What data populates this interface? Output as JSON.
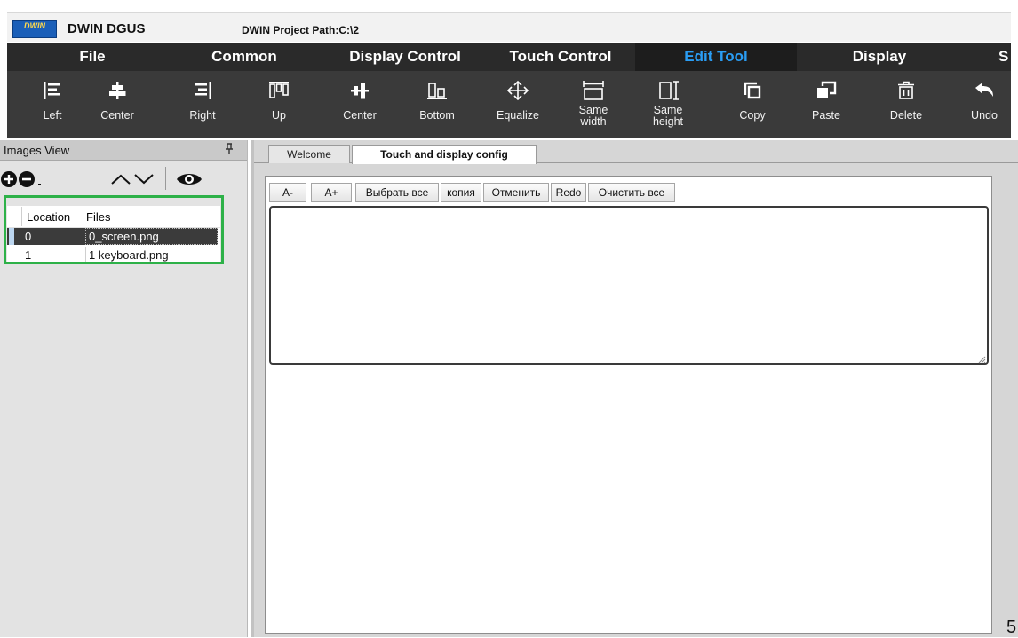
{
  "app": {
    "name": "DWIN DGUS",
    "logo_text": "DWIN",
    "project_path": "DWIN Project Path:C:\\2"
  },
  "menu": [
    {
      "label": "File"
    },
    {
      "label": "Common"
    },
    {
      "label": "Display Control"
    },
    {
      "label": "Touch Control"
    },
    {
      "label": "Edit Tool",
      "active": true
    },
    {
      "label": "Display"
    },
    {
      "label": "S"
    }
  ],
  "toolbar": [
    {
      "label": "Left",
      "icon": "align-left-icon"
    },
    {
      "label": "Center",
      "icon": "align-center-icon"
    },
    {
      "label": "Right",
      "icon": "align-right-icon"
    },
    {
      "label": "Up",
      "icon": "align-top-icon"
    },
    {
      "label": "Center",
      "icon": "align-middle-icon"
    },
    {
      "label": "Bottom",
      "icon": "align-bottom-icon"
    },
    {
      "label": "Equalize",
      "icon": "equalize-icon"
    },
    {
      "label": "Same width",
      "line1": "Same",
      "line2": "width",
      "icon": "same-width-icon"
    },
    {
      "label": "Same height",
      "line1": "Same",
      "line2": "height",
      "icon": "same-height-icon"
    },
    {
      "label": "Copy",
      "icon": "copy-icon"
    },
    {
      "label": "Paste",
      "icon": "paste-icon"
    },
    {
      "label": "Delete",
      "icon": "trash-icon"
    },
    {
      "label": "Undo",
      "icon": "undo-icon"
    }
  ],
  "images_view": {
    "title": "Images View",
    "columns": [
      "Location",
      "Files"
    ],
    "rows": [
      {
        "location": "0",
        "file": "0_screen.png",
        "selected": true
      },
      {
        "location": "1",
        "file": "1 keyboard.png",
        "selected": false
      }
    ]
  },
  "tabs": [
    {
      "label": "Welcome",
      "active": false
    },
    {
      "label": "Touch and display config",
      "active": true
    }
  ],
  "editor": {
    "buttons": [
      "A-",
      "A+",
      "Выбрать все",
      "копия",
      "Отменить",
      "Redo",
      "Очистить все"
    ],
    "text": ""
  },
  "stray_text": "5",
  "colors": {
    "menu_bg": "#2a2a2a",
    "toolbar_bg": "#3a3a3a",
    "active_menu_text": "#2a9df4",
    "highlight_box": "#2db148",
    "selected_row": "#3b3b3b"
  }
}
